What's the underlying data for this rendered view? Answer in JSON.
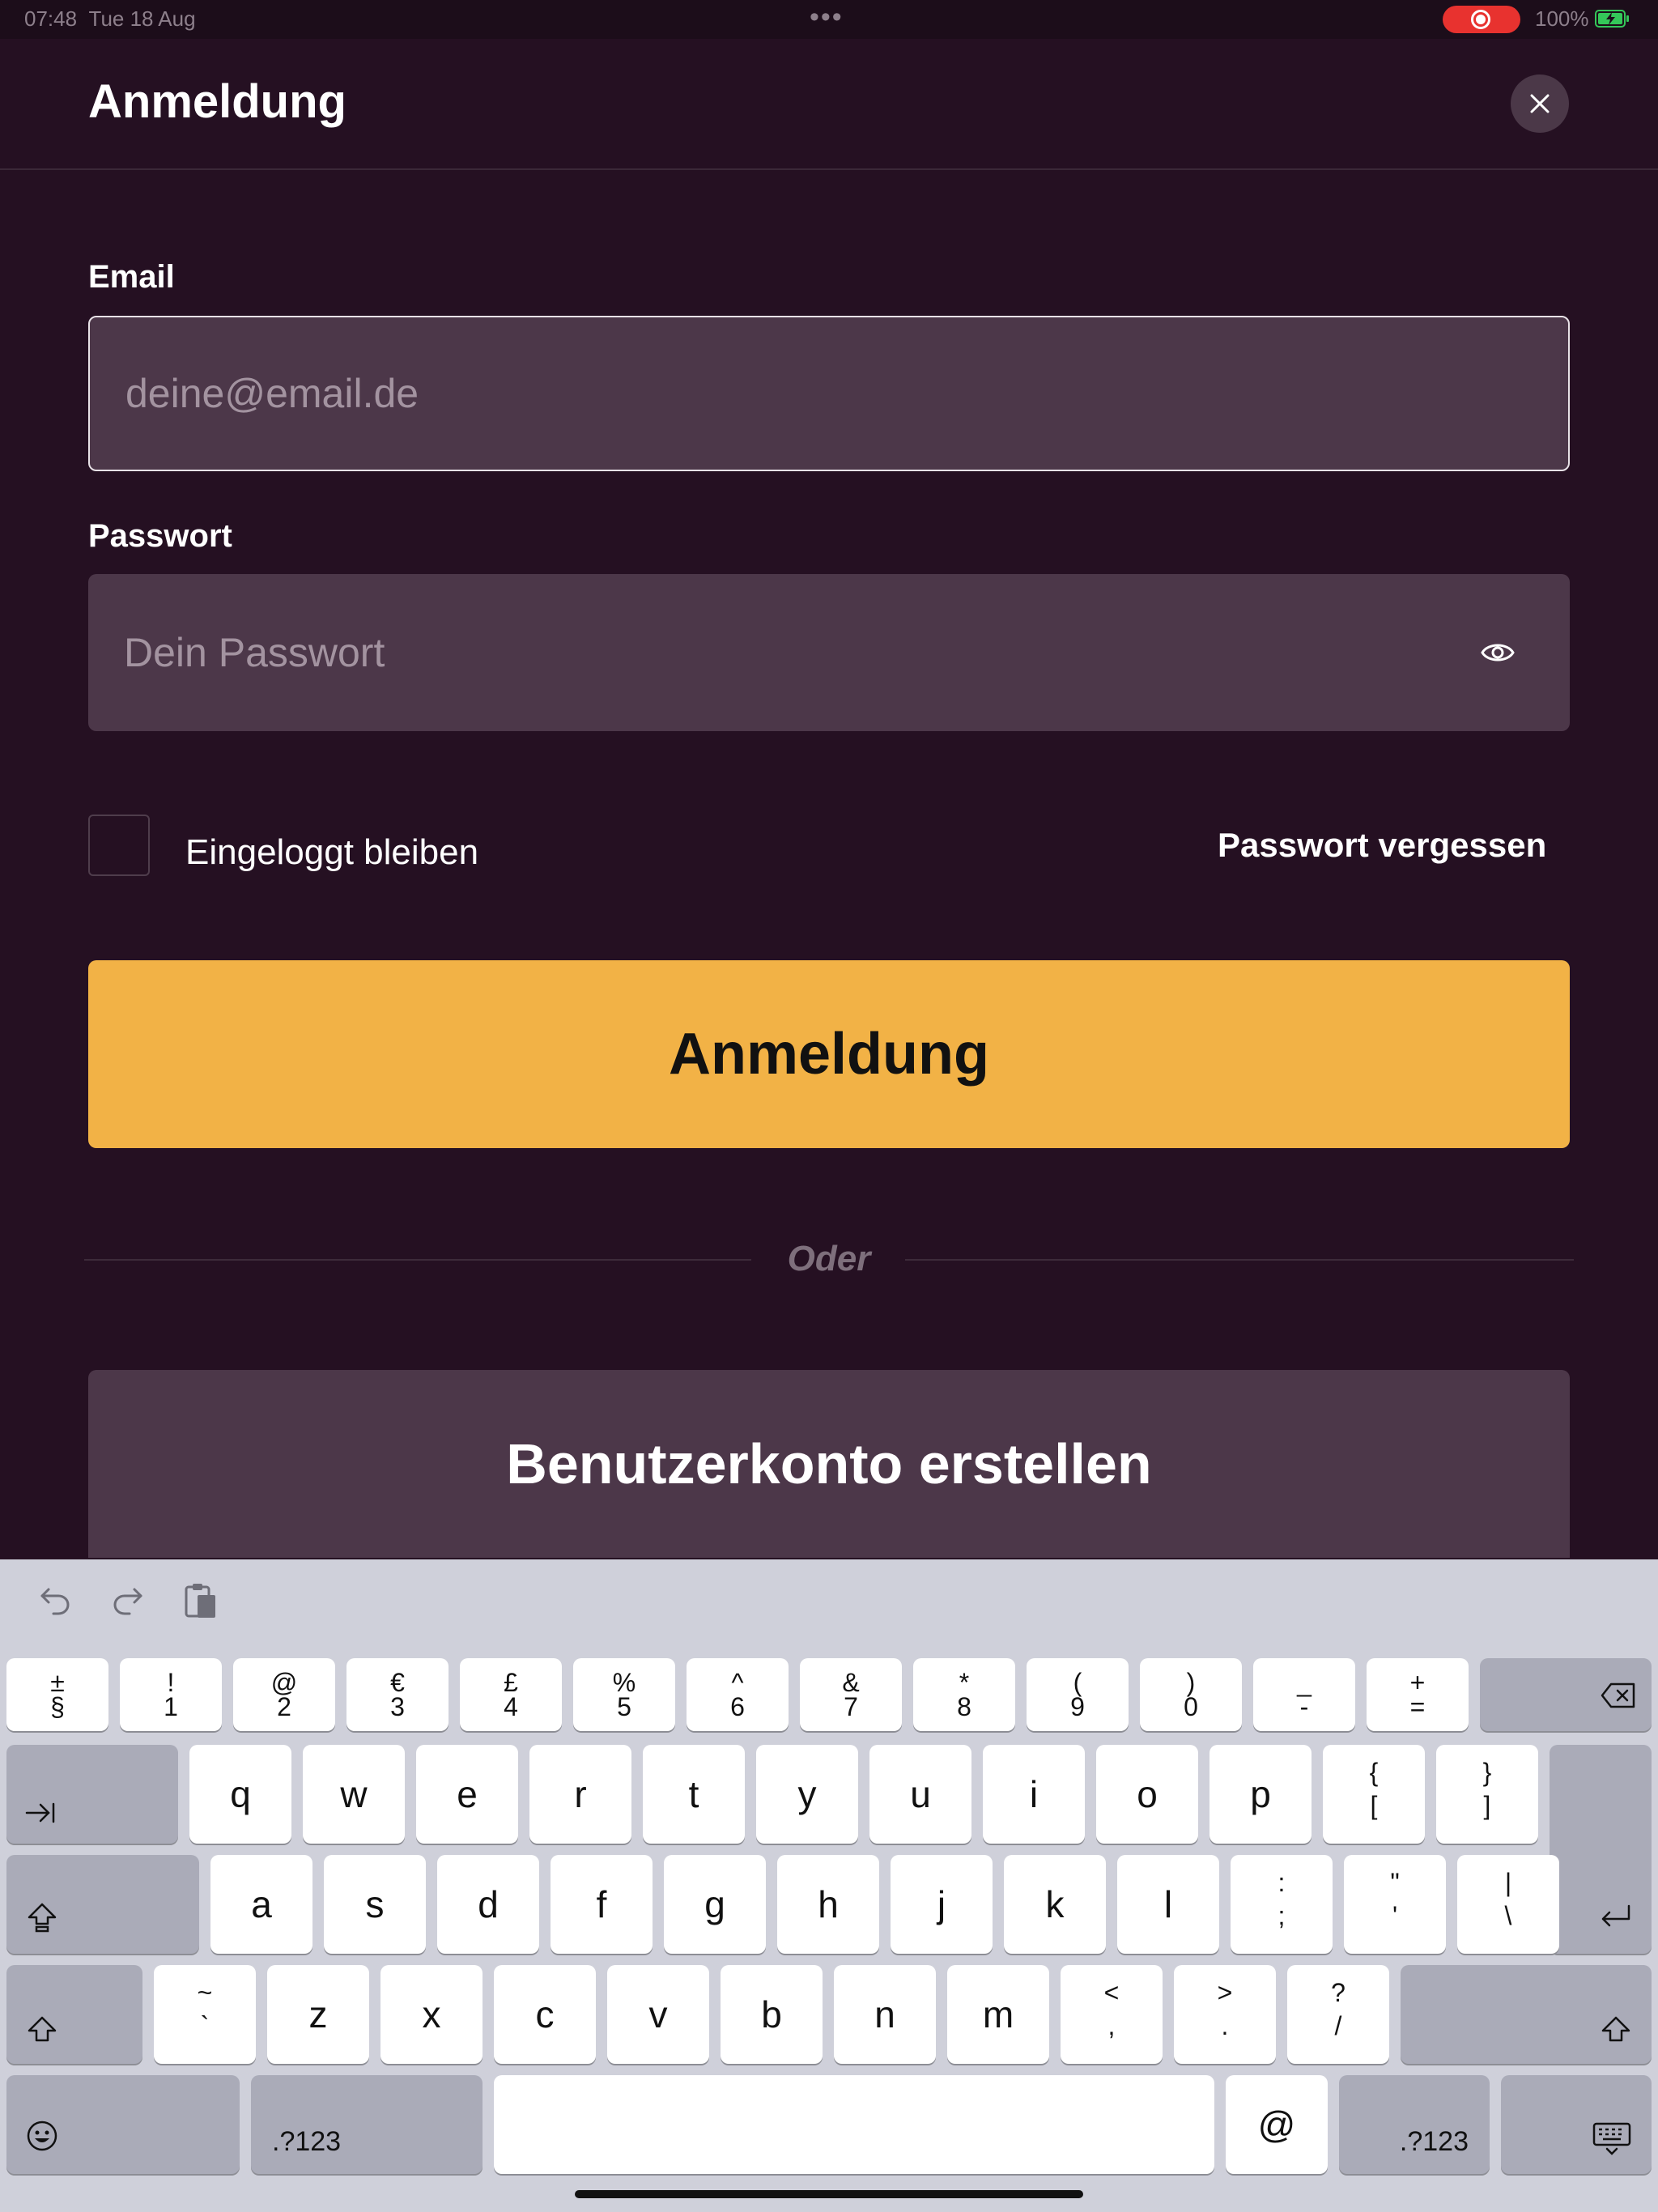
{
  "status_bar": {
    "time": "07:48",
    "date": "Tue 18 Aug",
    "battery": "100%"
  },
  "modal": {
    "title": "Anmeldung"
  },
  "form": {
    "email_label": "Email",
    "email_placeholder": "deine@email.de",
    "password_label": "Passwort",
    "password_placeholder": "Dein Passwort",
    "remember_label": "Eingeloggt bleiben",
    "remember_checked": false,
    "forgot_label": "Passwort vergessen",
    "login_label": "Anmeldung",
    "or_label": "Oder",
    "create_account_label": "Benutzerkonto erstellen"
  },
  "colors": {
    "background": "#251022",
    "input": "#4c3749",
    "accent": "#f2b246",
    "record": "#e8322f"
  },
  "keyboard": {
    "row1": [
      {
        "top": "±",
        "bottom": "§"
      },
      {
        "top": "!",
        "bottom": "1"
      },
      {
        "top": "@",
        "bottom": "2"
      },
      {
        "top": "€",
        "bottom": "3"
      },
      {
        "top": "£",
        "bottom": "4"
      },
      {
        "top": "%",
        "bottom": "5"
      },
      {
        "top": "^",
        "bottom": "6"
      },
      {
        "top": "&",
        "bottom": "7"
      },
      {
        "top": "*",
        "bottom": "8"
      },
      {
        "top": "(",
        "bottom": "9"
      },
      {
        "top": ")",
        "bottom": "0"
      },
      {
        "top": "_",
        "bottom": "-"
      },
      {
        "top": "+",
        "bottom": "="
      }
    ],
    "row2": [
      "q",
      "w",
      "e",
      "r",
      "t",
      "y",
      "u",
      "i",
      "o",
      "p"
    ],
    "row2_extra": [
      {
        "top": "{",
        "bottom": "["
      },
      {
        "top": "}",
        "bottom": "]"
      }
    ],
    "row3": [
      "a",
      "s",
      "d",
      "f",
      "g",
      "h",
      "j",
      "k",
      "l"
    ],
    "row3_extra": [
      {
        "top": ":",
        "bottom": ";"
      },
      {
        "top": "\"",
        "bottom": "'"
      },
      {
        "top": "|",
        "bottom": "\\"
      }
    ],
    "row4_first": {
      "top": "~",
      "bottom": "`"
    },
    "row4": [
      "z",
      "x",
      "c",
      "v",
      "b",
      "n",
      "m"
    ],
    "row4_extra": [
      {
        "top": "<",
        "bottom": ","
      },
      {
        "top": ">",
        "bottom": "."
      },
      {
        "top": "?",
        "bottom": "/"
      }
    ],
    "numbers_label": ".?123",
    "at_label": "@",
    "icons": {
      "backspace": "backspace-icon",
      "tab": "tab-icon",
      "capslock": "capslock-icon",
      "return": "return-icon",
      "shift": "shift-icon",
      "emoji": "emoji-icon",
      "dismiss": "keyboard-dismiss-icon",
      "undo": "undo-icon",
      "redo": "redo-icon",
      "paste": "paste-icon"
    }
  }
}
